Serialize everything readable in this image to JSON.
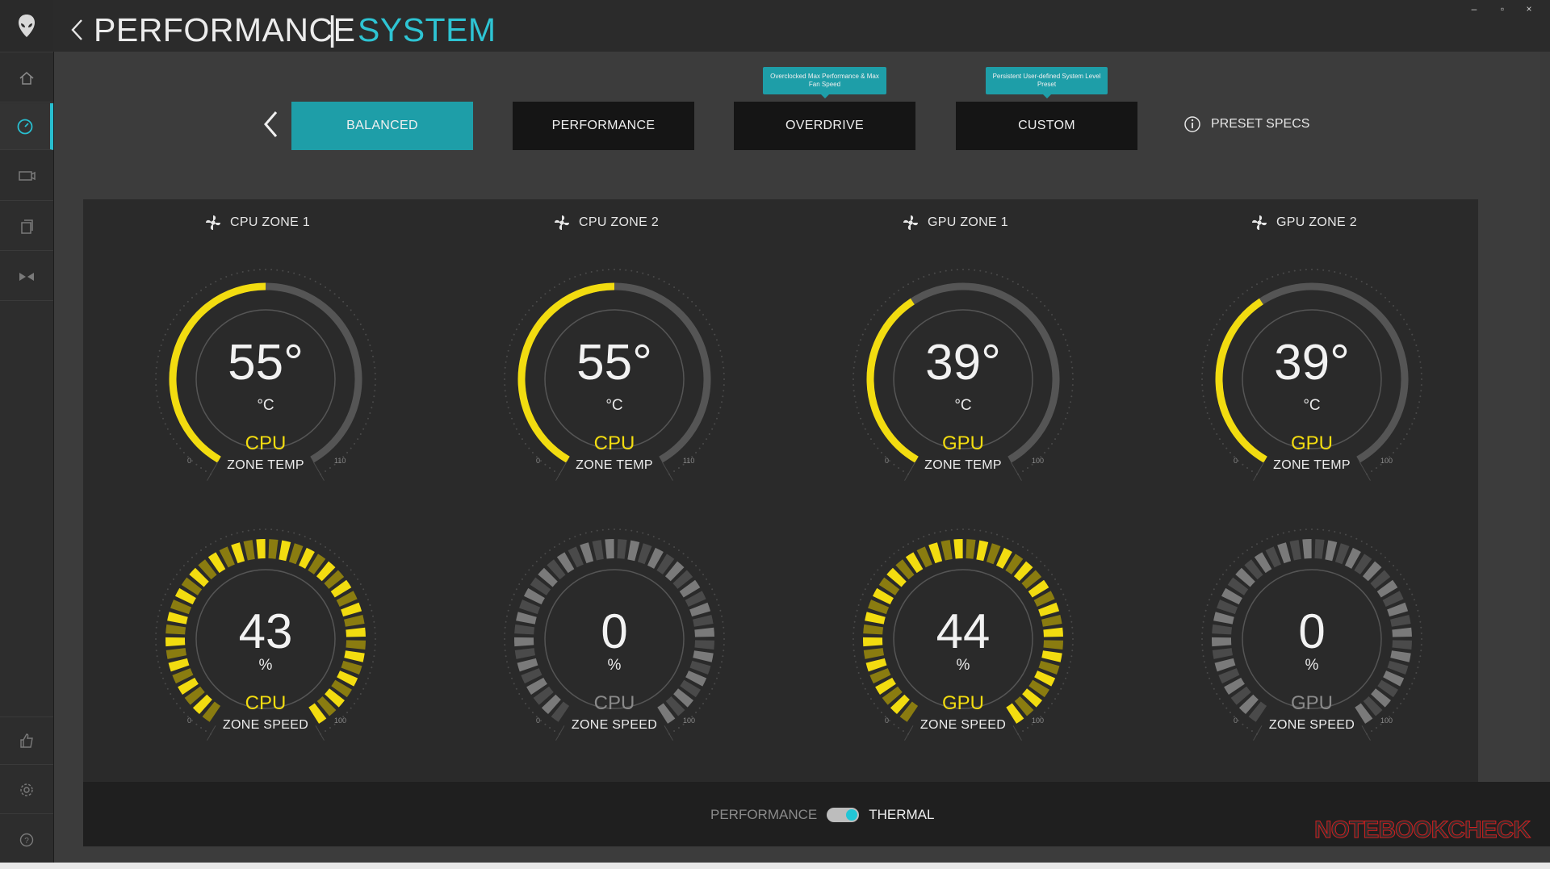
{
  "window": {
    "title_main": "PERFORMANCE",
    "title_separator": "|",
    "title_sub": "SYSTEM",
    "minimize": "–",
    "restore": "▫",
    "close": "×"
  },
  "sidebar": {
    "items": [
      {
        "icon": "home-icon"
      },
      {
        "icon": "performance-gauge-icon",
        "active": true
      },
      {
        "icon": "display-icon"
      },
      {
        "icon": "library-icon"
      },
      {
        "icon": "fx-icon"
      },
      {
        "icon": "thumbs-up-icon"
      },
      {
        "icon": "settings-icon"
      },
      {
        "icon": "help-icon"
      }
    ]
  },
  "presets": {
    "back_label": "‹",
    "items": [
      {
        "label": "BALANCED",
        "active": true
      },
      {
        "label": "PERFORMANCE",
        "active": false
      },
      {
        "label": "OVERDRIVE",
        "active": false,
        "tooltip": "Overclocked Max Performance & Max Fan Speed"
      },
      {
        "label": "CUSTOM",
        "active": false,
        "tooltip": "Persistent User-defined System Level Preset"
      }
    ],
    "specs_label": "PRESET SPECS"
  },
  "zones": [
    {
      "name": "CPU ZONE 1",
      "temp": {
        "value": "55°",
        "fraction": 0.5,
        "unit": "°C",
        "category": "CPU",
        "label": "ZONE TEMP",
        "min": "0",
        "max": "110"
      },
      "speed": {
        "value": "43",
        "fraction": 1.0,
        "unit": "%",
        "category": "CPU",
        "label": "ZONE SPEED",
        "min": "0",
        "max": "100",
        "active": true
      }
    },
    {
      "name": "CPU ZONE 2",
      "temp": {
        "value": "55°",
        "fraction": 0.5,
        "unit": "°C",
        "category": "CPU",
        "label": "ZONE TEMP",
        "min": "0",
        "max": "110"
      },
      "speed": {
        "value": "0",
        "fraction": 1.0,
        "unit": "%",
        "category": "CPU",
        "label": "ZONE SPEED",
        "min": "0",
        "max": "100",
        "active": false
      }
    },
    {
      "name": "GPU ZONE 1",
      "temp": {
        "value": "39°",
        "fraction": 0.39,
        "unit": "°C",
        "category": "GPU",
        "label": "ZONE TEMP",
        "min": "0",
        "max": "100"
      },
      "speed": {
        "value": "44",
        "fraction": 1.0,
        "unit": "%",
        "category": "GPU",
        "label": "ZONE SPEED",
        "min": "0",
        "max": "100",
        "active": true
      }
    },
    {
      "name": "GPU ZONE 2",
      "temp": {
        "value": "39°",
        "fraction": 0.39,
        "unit": "°C",
        "category": "GPU",
        "label": "ZONE TEMP",
        "min": "0",
        "max": "100"
      },
      "speed": {
        "value": "0",
        "fraction": 1.0,
        "unit": "%",
        "category": "GPU",
        "label": "ZONE SPEED",
        "min": "0",
        "max": "100",
        "active": false
      }
    }
  ],
  "footer": {
    "left_label": "PERFORMANCE",
    "right_label": "THERMAL",
    "toggle_state": "THERMAL"
  },
  "watermark": "NOTEBOOKCHECK",
  "colors": {
    "accent": "#1e9ea8",
    "accent_text": "#2ec4d3",
    "gauge_active": "#f2dc10",
    "gauge_inactive": "#555555",
    "zone_category_active": "#f2dc10",
    "zone_category_inactive": "#8a8a8a"
  }
}
